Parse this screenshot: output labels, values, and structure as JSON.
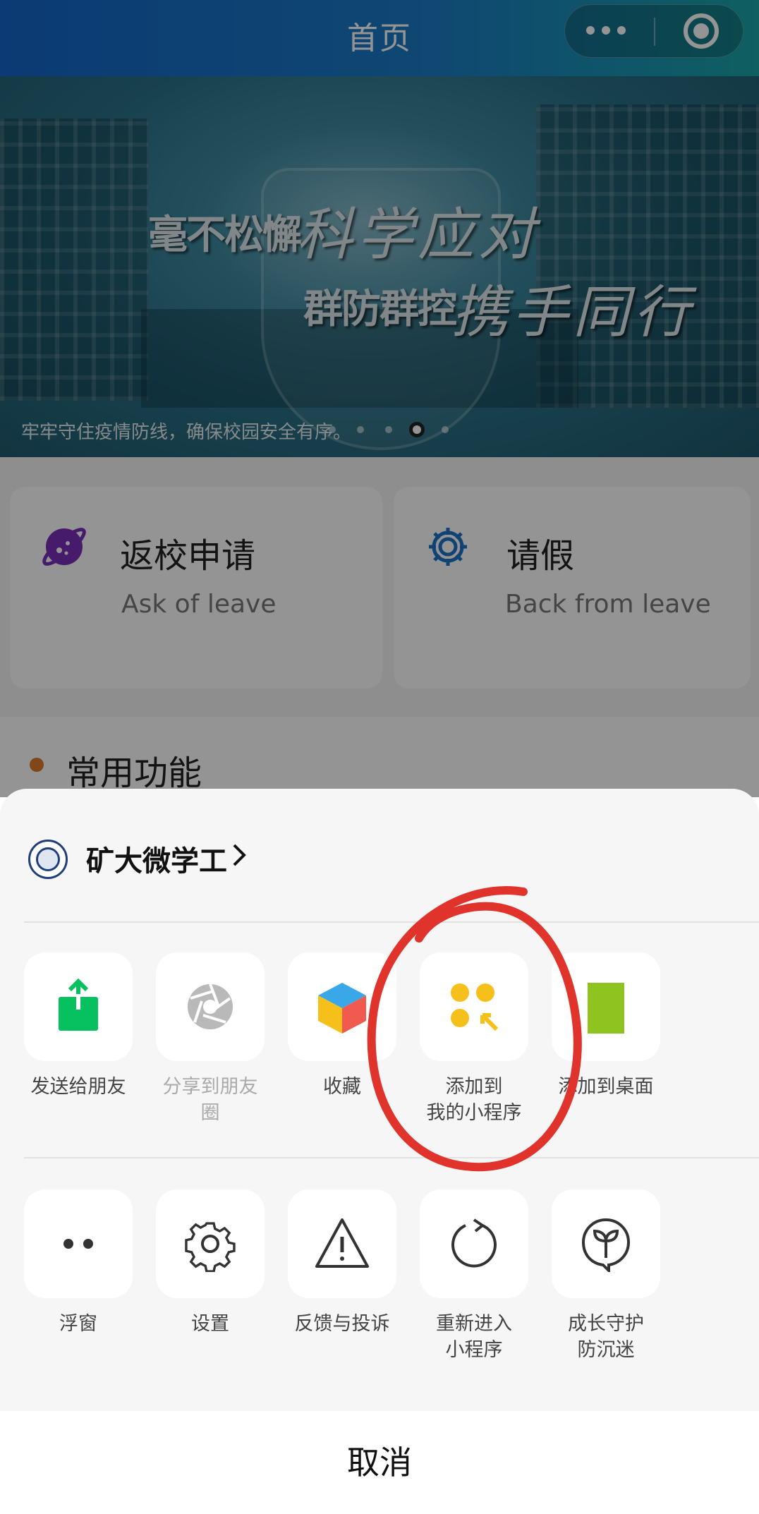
{
  "nav": {
    "title": "首页"
  },
  "banner": {
    "slogan_line1_left": "毫不松懈",
    "slogan_line1_right": "科学应对",
    "slogan_line2_left": "群防群控",
    "slogan_line2_right": "携手同行",
    "caption": "牢牢守住疫情防线，确保校园安全有序。",
    "carousel": {
      "count": 5,
      "active_index": 3
    }
  },
  "cards": [
    {
      "title": "返校申请",
      "subtitle": "Ask of leave",
      "icon": "planet-icon",
      "color": "#7b2fb8"
    },
    {
      "title": "请假",
      "subtitle": "Back from leave",
      "icon": "gear-icon",
      "color": "#1e73c8"
    }
  ],
  "section": {
    "title": "常用功能"
  },
  "sheet": {
    "app_name": "矿大微学工",
    "chevron": "›",
    "row1": [
      {
        "label": "发送给朋友",
        "icon": "share-to-friend-icon",
        "color": "#07c160",
        "muted": false
      },
      {
        "label": "分享到朋友\n圈",
        "icon": "moments-shutter-icon",
        "color": "#b9b9b9",
        "muted": true
      },
      {
        "label": "收藏",
        "icon": "favorites-cube-icon",
        "color": "#3aa8e8",
        "muted": false
      },
      {
        "label": "添加到\n我的小程序",
        "icon": "add-to-my-miniprogram-icon",
        "color": "#f5c01a",
        "muted": false
      },
      {
        "label": "添加到桌面",
        "icon": "add-to-desktop-icon",
        "color": "#8fc31f",
        "muted": false
      }
    ],
    "row2": [
      {
        "label": "浮窗",
        "icon": "float-window-icon"
      },
      {
        "label": "设置",
        "icon": "settings-gear-icon"
      },
      {
        "label": "反馈与投诉",
        "icon": "warning-triangle-icon"
      },
      {
        "label": "重新进入\n小程序",
        "icon": "reload-icon"
      },
      {
        "label": "成长守护\n防沉迷",
        "icon": "sprout-icon"
      }
    ],
    "cancel": "取消"
  },
  "annotation_color": "#e0332c"
}
